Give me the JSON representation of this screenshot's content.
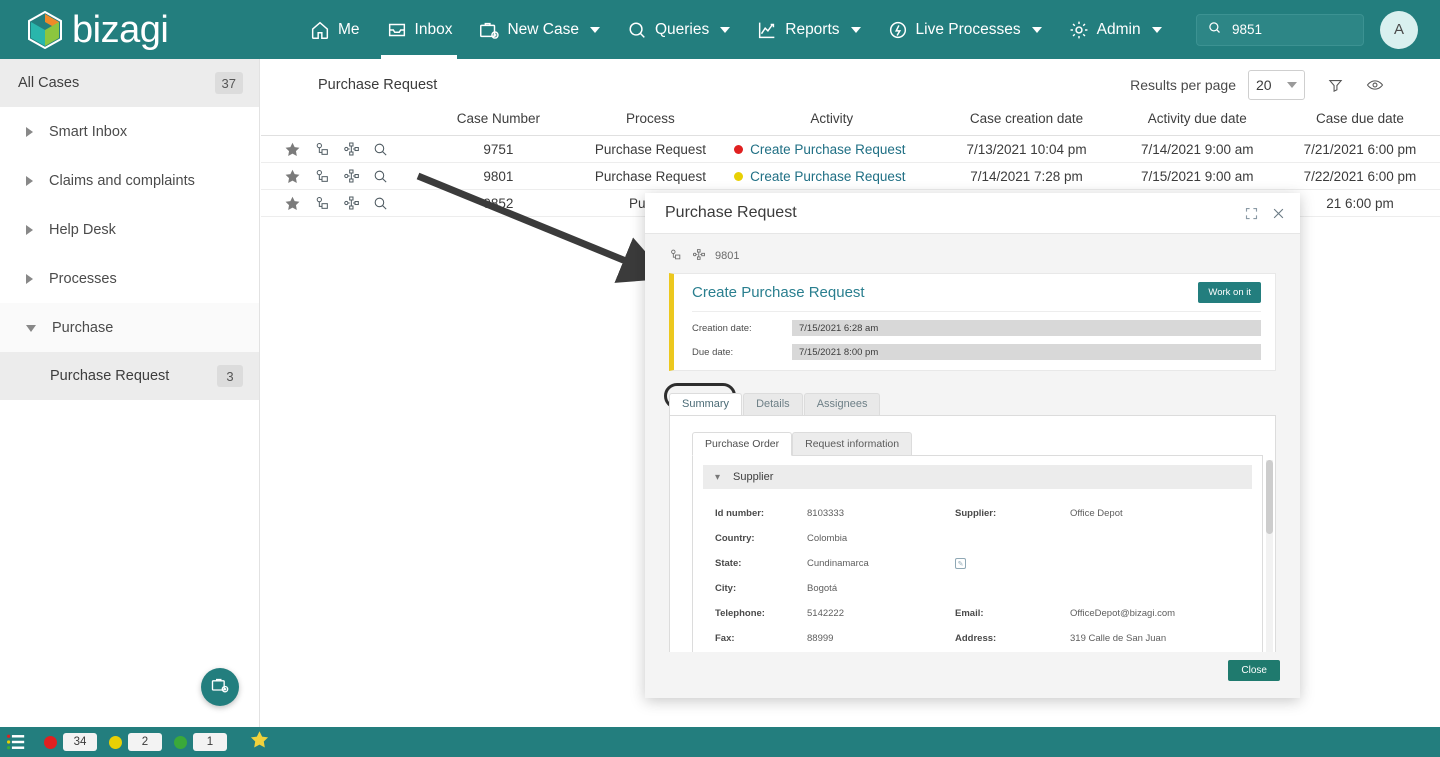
{
  "brand": {
    "name": "bizagi",
    "teal": "#237e7e"
  },
  "topnav": {
    "items": [
      {
        "label": "Me",
        "icon": "home-icon",
        "caret": false,
        "active": false
      },
      {
        "label": "Inbox",
        "icon": "inbox-icon",
        "caret": false,
        "active": true
      },
      {
        "label": "New Case",
        "icon": "briefcase-plus-icon",
        "caret": true,
        "active": false
      },
      {
        "label": "Queries",
        "icon": "search-icon",
        "caret": true,
        "active": false
      },
      {
        "label": "Reports",
        "icon": "chart-icon",
        "caret": true,
        "active": false
      },
      {
        "label": "Live Processes",
        "icon": "live-processes-icon",
        "caret": true,
        "active": false
      },
      {
        "label": "Admin",
        "icon": "gear-icon",
        "caret": true,
        "active": false
      }
    ],
    "search": {
      "value": "9851",
      "placeholder": "Search",
      "icon": "search-icon"
    },
    "avatar": {
      "initial": "A"
    }
  },
  "sidebar": {
    "all_cases": {
      "label": "All Cases",
      "count": "37"
    },
    "items": [
      {
        "label": "Smart Inbox",
        "expanded": false
      },
      {
        "label": "Claims and complaints",
        "expanded": false
      },
      {
        "label": "Help Desk",
        "expanded": false
      },
      {
        "label": "Processes",
        "expanded": false
      },
      {
        "label": "Purchase",
        "expanded": true
      }
    ],
    "subitem": {
      "label": "Purchase Request",
      "count": "3"
    },
    "fab": {
      "icon": "new-case-icon"
    }
  },
  "main": {
    "title": "Purchase Request",
    "results_per_page_label": "Results per page",
    "results_per_page_value": "20",
    "filter_icon": "filter-icon",
    "view_icon": "eye-icon",
    "columns": [
      "",
      "Case Number",
      "Process",
      "Activity",
      "Case creation date",
      "Activity due date",
      "Case due date"
    ],
    "rows": [
      {
        "case_number": "9751",
        "process": "Purchase Request",
        "activity": "Create Purchase Request",
        "status_color": "#e02020",
        "case_creation_date": "7/13/2021 10:04 pm",
        "activity_due_date": "7/14/2021 9:00 am",
        "case_due_date": "7/21/2021 6:00 pm"
      },
      {
        "case_number": "9801",
        "process": "Purchase Request",
        "activity": "Create Purchase Request",
        "status_color": "#e8d004",
        "case_creation_date": "7/14/2021 7:28 pm",
        "activity_due_date": "7/15/2021 9:00 am",
        "case_due_date": "7/22/2021 6:00 pm"
      },
      {
        "case_number": "9852",
        "process": "Purcha",
        "activity": "",
        "status_color": "",
        "case_creation_date": "",
        "activity_due_date": "",
        "case_due_date": "21 6:00 pm"
      }
    ],
    "row_icons": [
      "star-icon",
      "related-cases-icon",
      "process-diagram-icon",
      "search-icon"
    ]
  },
  "modal": {
    "title": "Purchase Request",
    "expand_icon": "expand-icon",
    "close_icon": "close-icon",
    "case_number": "9801",
    "case_icons": [
      "related-cases-icon",
      "process-diagram-icon"
    ],
    "activity": {
      "name": "Create Purchase Request",
      "work_button": "Work on it",
      "accent_color": "#ecc81e",
      "fields": [
        {
          "label": "Creation date:",
          "value": "7/15/2021 6:28 am"
        },
        {
          "label": "Due date:",
          "value": "7/15/2021 8:00 pm"
        }
      ]
    },
    "tabs": [
      {
        "label": "Summary",
        "active": true
      },
      {
        "label": "Details",
        "active": false
      },
      {
        "label": "Assignees",
        "active": false
      }
    ],
    "subtabs": [
      {
        "label": "Purchase Order",
        "active": true
      },
      {
        "label": "Request information",
        "active": false
      }
    ],
    "section": {
      "label": "Supplier",
      "chevron": "chevron-down-icon"
    },
    "form_rows": [
      {
        "label": "Id number:",
        "value": "8103333",
        "label2": "Supplier:",
        "value2": "Office Depot",
        "note": false
      },
      {
        "label": "Country:",
        "value": "Colombia",
        "label2": "",
        "value2": "",
        "note": false
      },
      {
        "label": "State:",
        "value": "Cundinamarca",
        "label2": "",
        "value2": "",
        "note": true
      },
      {
        "label": "City:",
        "value": "Bogotá",
        "label2": "",
        "value2": "",
        "note": false
      },
      {
        "label": "Telephone:",
        "value": "5142222",
        "label2": "Email:",
        "value2": "OfficeDepot@bizagi.com",
        "note": false
      },
      {
        "label": "Fax:",
        "value": "88999",
        "label2": "Address:",
        "value2": "319 Calle de San Juan",
        "note": false
      }
    ],
    "close_button": "Close"
  },
  "statusbar": {
    "menu_icon": "list-menu-icon",
    "counters": [
      {
        "color": "#e02020",
        "count": "34"
      },
      {
        "color": "#e8d004",
        "count": "2"
      },
      {
        "color": "#3aa93a",
        "count": "1"
      }
    ],
    "star_icon": "star-icon"
  }
}
